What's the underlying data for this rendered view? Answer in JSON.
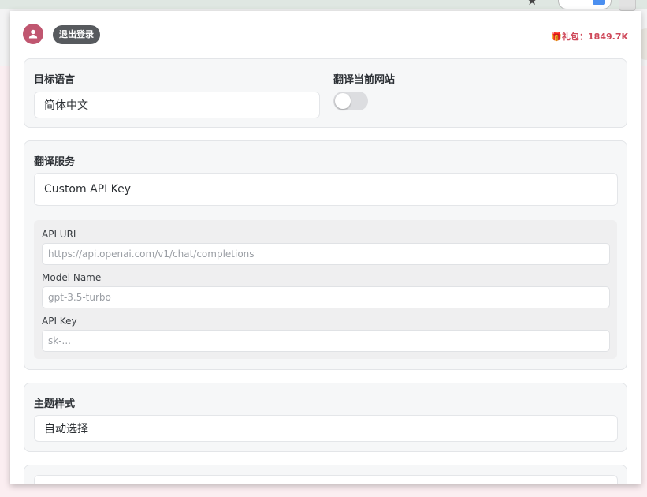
{
  "header": {
    "logout_label": "退出登录",
    "gift_label": "🎁礼包：1849.7K",
    "avatar_icon": "user-icon"
  },
  "language_section": {
    "target_language_label": "目标语言",
    "target_language_value": "简体中文",
    "translate_site_label": "翻译当前网站",
    "translate_site_enabled": false
  },
  "service_section": {
    "label": "翻译服务",
    "selected": "Custom API Key",
    "api_url_label": "API URL",
    "api_url_placeholder": "https://api.openai.com/v1/chat/completions",
    "model_name_label": "Model Name",
    "model_name_placeholder": "gpt-3.5-turbo",
    "api_key_label": "API Key",
    "api_key_placeholder": "sk-..."
  },
  "theme_section": {
    "label": "主题样式",
    "selected": "自动选择"
  },
  "colors": {
    "accent_avatar": "#c05670",
    "gift_text": "#cf4a5b",
    "logout_bg": "#575a5e"
  }
}
